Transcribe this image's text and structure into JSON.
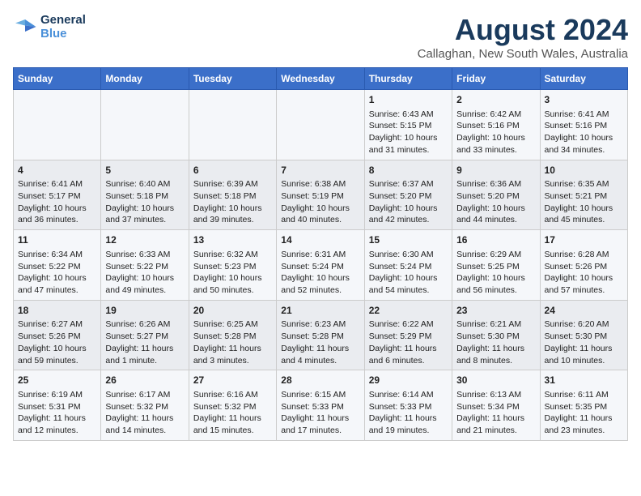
{
  "header": {
    "logo_line1": "General",
    "logo_line2": "Blue",
    "main_title": "August 2024",
    "subtitle": "Callaghan, New South Wales, Australia"
  },
  "days_of_week": [
    "Sunday",
    "Monday",
    "Tuesday",
    "Wednesday",
    "Thursday",
    "Friday",
    "Saturday"
  ],
  "weeks": [
    [
      {
        "day": "",
        "content": ""
      },
      {
        "day": "",
        "content": ""
      },
      {
        "day": "",
        "content": ""
      },
      {
        "day": "",
        "content": ""
      },
      {
        "day": "1",
        "content": "Sunrise: 6:43 AM\nSunset: 5:15 PM\nDaylight: 10 hours\nand 31 minutes."
      },
      {
        "day": "2",
        "content": "Sunrise: 6:42 AM\nSunset: 5:16 PM\nDaylight: 10 hours\nand 33 minutes."
      },
      {
        "day": "3",
        "content": "Sunrise: 6:41 AM\nSunset: 5:16 PM\nDaylight: 10 hours\nand 34 minutes."
      }
    ],
    [
      {
        "day": "4",
        "content": "Sunrise: 6:41 AM\nSunset: 5:17 PM\nDaylight: 10 hours\nand 36 minutes."
      },
      {
        "day": "5",
        "content": "Sunrise: 6:40 AM\nSunset: 5:18 PM\nDaylight: 10 hours\nand 37 minutes."
      },
      {
        "day": "6",
        "content": "Sunrise: 6:39 AM\nSunset: 5:18 PM\nDaylight: 10 hours\nand 39 minutes."
      },
      {
        "day": "7",
        "content": "Sunrise: 6:38 AM\nSunset: 5:19 PM\nDaylight: 10 hours\nand 40 minutes."
      },
      {
        "day": "8",
        "content": "Sunrise: 6:37 AM\nSunset: 5:20 PM\nDaylight: 10 hours\nand 42 minutes."
      },
      {
        "day": "9",
        "content": "Sunrise: 6:36 AM\nSunset: 5:20 PM\nDaylight: 10 hours\nand 44 minutes."
      },
      {
        "day": "10",
        "content": "Sunrise: 6:35 AM\nSunset: 5:21 PM\nDaylight: 10 hours\nand 45 minutes."
      }
    ],
    [
      {
        "day": "11",
        "content": "Sunrise: 6:34 AM\nSunset: 5:22 PM\nDaylight: 10 hours\nand 47 minutes."
      },
      {
        "day": "12",
        "content": "Sunrise: 6:33 AM\nSunset: 5:22 PM\nDaylight: 10 hours\nand 49 minutes."
      },
      {
        "day": "13",
        "content": "Sunrise: 6:32 AM\nSunset: 5:23 PM\nDaylight: 10 hours\nand 50 minutes."
      },
      {
        "day": "14",
        "content": "Sunrise: 6:31 AM\nSunset: 5:24 PM\nDaylight: 10 hours\nand 52 minutes."
      },
      {
        "day": "15",
        "content": "Sunrise: 6:30 AM\nSunset: 5:24 PM\nDaylight: 10 hours\nand 54 minutes."
      },
      {
        "day": "16",
        "content": "Sunrise: 6:29 AM\nSunset: 5:25 PM\nDaylight: 10 hours\nand 56 minutes."
      },
      {
        "day": "17",
        "content": "Sunrise: 6:28 AM\nSunset: 5:26 PM\nDaylight: 10 hours\nand 57 minutes."
      }
    ],
    [
      {
        "day": "18",
        "content": "Sunrise: 6:27 AM\nSunset: 5:26 PM\nDaylight: 10 hours\nand 59 minutes."
      },
      {
        "day": "19",
        "content": "Sunrise: 6:26 AM\nSunset: 5:27 PM\nDaylight: 11 hours\nand 1 minute."
      },
      {
        "day": "20",
        "content": "Sunrise: 6:25 AM\nSunset: 5:28 PM\nDaylight: 11 hours\nand 3 minutes."
      },
      {
        "day": "21",
        "content": "Sunrise: 6:23 AM\nSunset: 5:28 PM\nDaylight: 11 hours\nand 4 minutes."
      },
      {
        "day": "22",
        "content": "Sunrise: 6:22 AM\nSunset: 5:29 PM\nDaylight: 11 hours\nand 6 minutes."
      },
      {
        "day": "23",
        "content": "Sunrise: 6:21 AM\nSunset: 5:30 PM\nDaylight: 11 hours\nand 8 minutes."
      },
      {
        "day": "24",
        "content": "Sunrise: 6:20 AM\nSunset: 5:30 PM\nDaylight: 11 hours\nand 10 minutes."
      }
    ],
    [
      {
        "day": "25",
        "content": "Sunrise: 6:19 AM\nSunset: 5:31 PM\nDaylight: 11 hours\nand 12 minutes."
      },
      {
        "day": "26",
        "content": "Sunrise: 6:17 AM\nSunset: 5:32 PM\nDaylight: 11 hours\nand 14 minutes."
      },
      {
        "day": "27",
        "content": "Sunrise: 6:16 AM\nSunset: 5:32 PM\nDaylight: 11 hours\nand 15 minutes."
      },
      {
        "day": "28",
        "content": "Sunrise: 6:15 AM\nSunset: 5:33 PM\nDaylight: 11 hours\nand 17 minutes."
      },
      {
        "day": "29",
        "content": "Sunrise: 6:14 AM\nSunset: 5:33 PM\nDaylight: 11 hours\nand 19 minutes."
      },
      {
        "day": "30",
        "content": "Sunrise: 6:13 AM\nSunset: 5:34 PM\nDaylight: 11 hours\nand 21 minutes."
      },
      {
        "day": "31",
        "content": "Sunrise: 6:11 AM\nSunset: 5:35 PM\nDaylight: 11 hours\nand 23 minutes."
      }
    ]
  ]
}
